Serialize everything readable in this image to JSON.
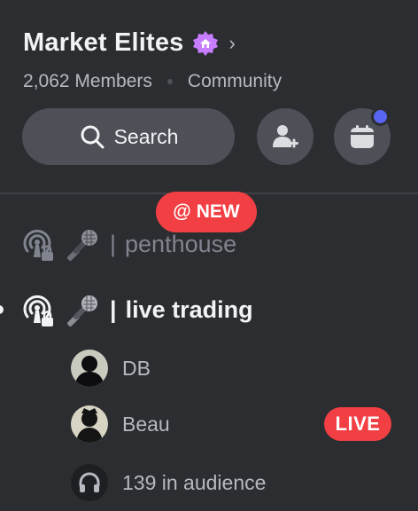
{
  "server": {
    "name": "Market Elites",
    "members": "2,062 Members",
    "type": "Community"
  },
  "actions": {
    "search_label": "Search"
  },
  "new_pill": {
    "label": "NEW",
    "prefix": "@"
  },
  "channels": [
    {
      "name": "penthouse",
      "separator": "|",
      "unread": false
    },
    {
      "name": "live trading",
      "separator": "|",
      "unread": true
    }
  ],
  "participants": [
    {
      "name": "DB",
      "live": false
    },
    {
      "name": "Beau",
      "live": true,
      "badge": "LIVE"
    }
  ],
  "audience": {
    "label": "139 in audience"
  },
  "colors": {
    "background": "#2b2d31",
    "accent": "#5865f2",
    "live_red": "#f23f43",
    "boost_purple": "#c77dff"
  },
  "icons": [
    "boost-icon",
    "chevron-right-icon",
    "search-icon",
    "add-user-icon",
    "calendar-icon",
    "stage-icon",
    "microphone-icon",
    "headphones-icon"
  ]
}
